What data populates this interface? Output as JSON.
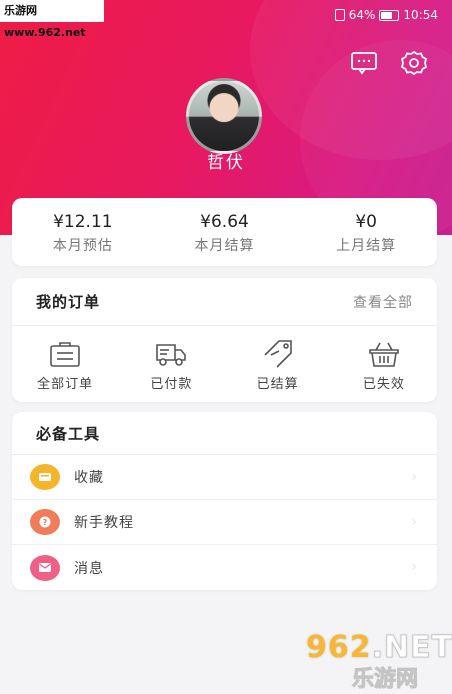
{
  "watermark": "乐游网 www.962.net",
  "statusbar": {
    "battery": "64%",
    "time": "10:54"
  },
  "header": {
    "message_icon": "message-icon",
    "settings_icon": "settings-icon",
    "username": "哲伏"
  },
  "stats": [
    {
      "value": "¥12.11",
      "label": "本月预估"
    },
    {
      "value": "¥6.64",
      "label": "本月结算"
    },
    {
      "value": "¥0",
      "label": "上月结算"
    }
  ],
  "orders": {
    "title": "我的订单",
    "view_all": "查看全部",
    "items": [
      {
        "label": "全部订单",
        "icon": "orders-icon"
      },
      {
        "label": "已付款",
        "icon": "truck-icon"
      },
      {
        "label": "已结算",
        "icon": "tag-icon"
      },
      {
        "label": "已失效",
        "icon": "basket-icon"
      }
    ]
  },
  "tools": {
    "title": "必备工具",
    "items": [
      {
        "label": "收藏",
        "icon": "favorites-icon",
        "color": "#f5b52b"
      },
      {
        "label": "新手教程",
        "icon": "tutorial-icon",
        "color": "#f07c5a"
      },
      {
        "label": "消息",
        "icon": "mail-icon",
        "color": "#ef5f86"
      }
    ]
  },
  "logo": {
    "big": "962",
    "net": ".NET",
    "small": "乐游网"
  },
  "colors": {
    "accent": "#e8195f",
    "header_start": "#ee1c45",
    "header_end": "#c8208f"
  }
}
